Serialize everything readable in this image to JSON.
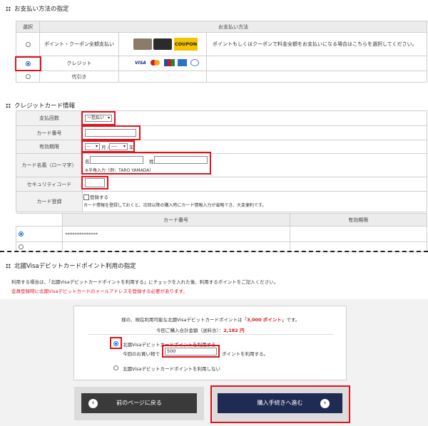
{
  "payment_section": {
    "title": "お支払い方法の指定",
    "col_select": "選択",
    "col_method": "お支払い方法",
    "rows": [
      {
        "label": "ポイント・クーポン全額支払い",
        "note": "ポイントもしくはクーポンで料金全額をお支払いになる場合はこちらを選択してください。",
        "selected": false,
        "coupon_label": "COUPON"
      },
      {
        "label": "クレジット",
        "selected": true,
        "brands": [
          "VISA",
          "MC",
          "JCB",
          "AMEX",
          "Diners"
        ]
      },
      {
        "label": "代引き",
        "selected": false
      }
    ]
  },
  "card_section": {
    "title": "クレジットカード情報",
    "installments_label": "支払回数",
    "installments_value": "一括払い",
    "number_label": "カード番号",
    "number_value": "",
    "expiry_label": "有効期限",
    "expiry_month": "--",
    "expiry_month_unit": "月 /",
    "expiry_year": "----",
    "expiry_year_unit": "年",
    "name_label": "カード名義（ローマ字）",
    "name_first_label": "名",
    "name_last_label": "姓",
    "name_hint": "※半角入力（例：TARO YAMADA）",
    "security_label": "セキュリティコード",
    "register_label": "カード登録",
    "register_checkbox_label": "登録する",
    "register_note": "カード情報を登録しておくと、次回以降の購入時にカード情報入力が省略でき、大変便利です。",
    "saved_col_number": "カード番号",
    "saved_col_expiry": "有効期限",
    "saved_rows": [
      {
        "number": "**************",
        "expiry": "",
        "selected": true
      },
      {
        "number": "",
        "expiry": "",
        "selected": false
      }
    ]
  },
  "points_section": {
    "title": "北國Visaデビットカードポイント利用の指定",
    "intro": "利用する場合は、「北國Visaデビットカードポイントを利用する」にチェックを入れた後、利用するポイントをご記入ください。",
    "warning": "会員登録時に北國Visaデビットカードのメールアドレスを登録する必要があります。",
    "available_prefix": "様の、現在利用可能な北國Visaデビットカードポイントは「",
    "available_points": "3,000 ポイント",
    "available_suffix": "」です。",
    "total_label": "今回ご購入合計金額（送料含）：",
    "total_value": "2,182 円",
    "use_option": "北國Visaデビットカードポイントを利用する",
    "use_prefix": "今回のお買い物で",
    "use_value": "500",
    "use_suffix": "ポイントを利用する。",
    "nouse_option": "北國Visaデビットカードポイントを利用しない",
    "use_selected": true
  },
  "buttons": {
    "back": "前のページに戻る",
    "proceed": "購入手続きへ進む",
    "back_color": "#3a3a3a",
    "proceed_color": "#1f2b52"
  },
  "colors": {
    "highlight": "#e0141e",
    "warning": "#e0141e",
    "accent": "#1a6fd1"
  }
}
